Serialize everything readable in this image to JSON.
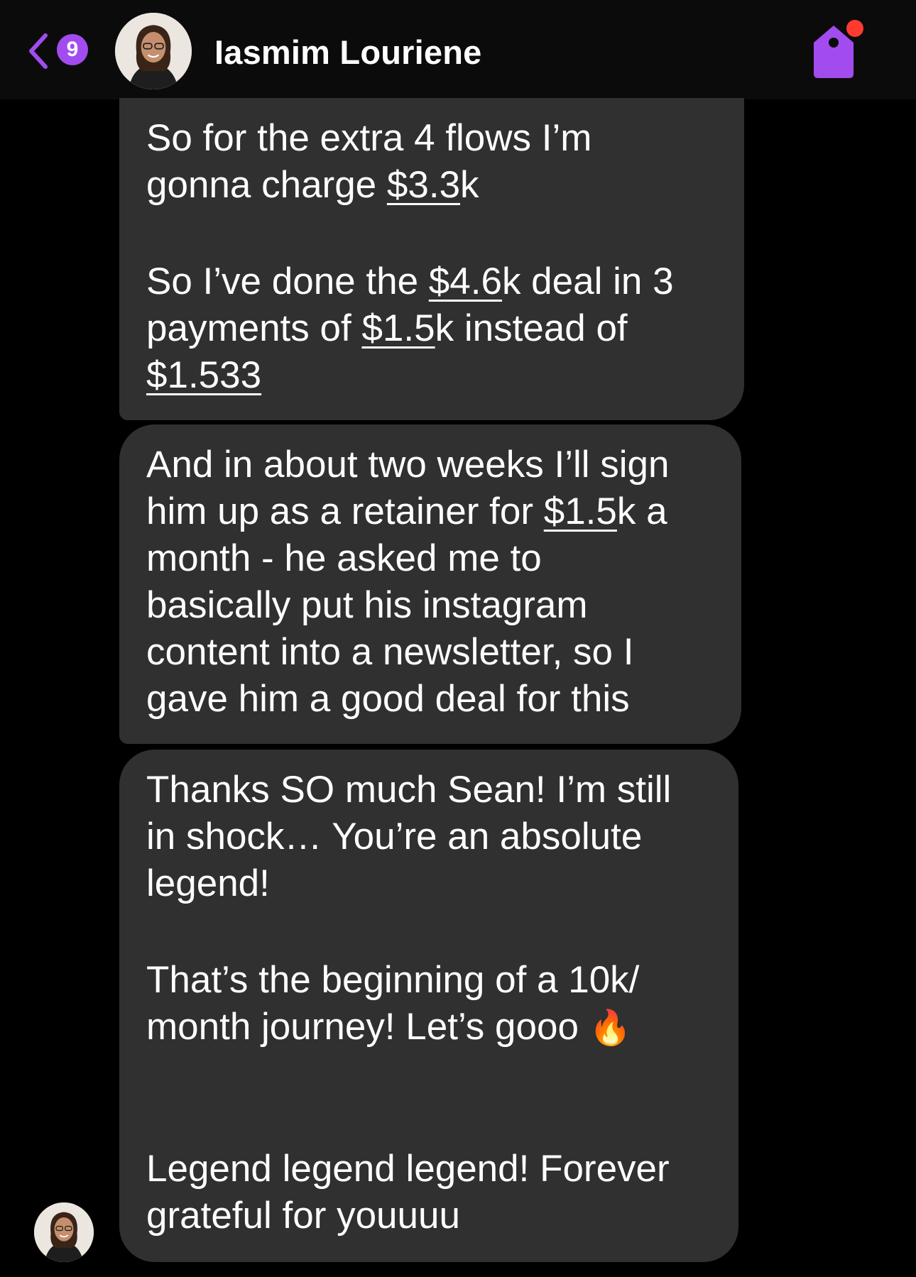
{
  "header": {
    "unread_count": "9",
    "contact_name": "Iasmim Louriene",
    "back_icon": "chevron-left-icon",
    "tag_icon": "tag-icon",
    "accent_color": "#a24cf0",
    "notification_color": "#ff3b30"
  },
  "messages": {
    "m1": {
      "l1": "So for the extra 4 flows I’m",
      "l2a": "gonna charge ",
      "l2u": "$3.3",
      "l2b": "k",
      "l3a": "So I’ve done the ",
      "l3u": "$4.6",
      "l3b": "k deal in 3",
      "l4a": "payments of ",
      "l4u": "$1.5",
      "l4b": "k instead of",
      "l5u": "$1.533"
    },
    "m2": {
      "l1": "And in about two weeks I’ll sign",
      "l2a": "him up as a retainer for ",
      "l2u": "$1.5",
      "l2b": "k a",
      "l3": "month - he asked me to",
      "l4": "basically put his instagram",
      "l5": "content into a newsletter, so I",
      "l6": "gave him a good deal for this"
    },
    "m3": {
      "l1": "Thanks SO much Sean! I’m still",
      "l2": "in shock… You’re an absolute",
      "l3": "legend!",
      "l4": "That’s the beginning of a 10k/",
      "l5": "month journey! Let’s gooo",
      "l5_emoji": "🔥",
      "l6": "Legend legend legend! Forever",
      "l7": "grateful for youuuu"
    }
  }
}
